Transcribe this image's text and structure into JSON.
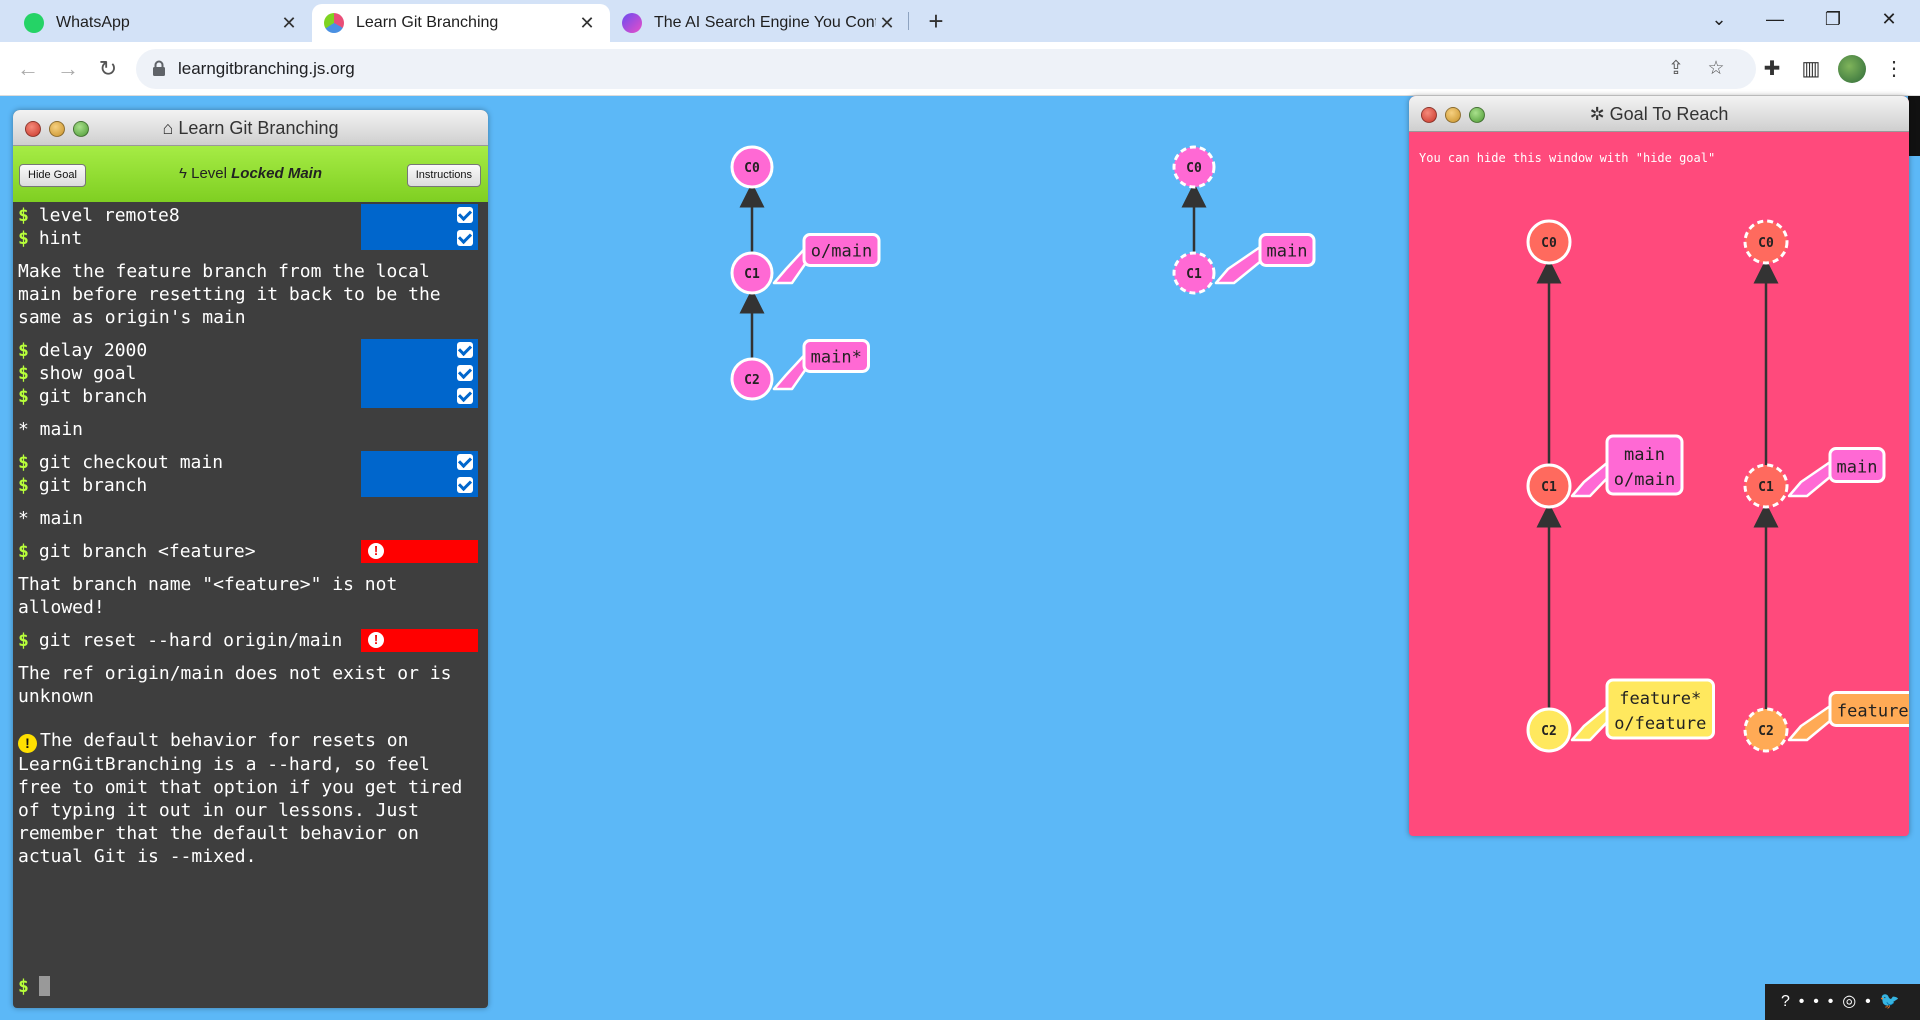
{
  "browser": {
    "tabs": [
      {
        "title": "WhatsApp"
      },
      {
        "title": "Learn Git Branching"
      },
      {
        "title": "The AI Search Engine You Contro"
      }
    ],
    "url": "learngitbranching.js.org"
  },
  "terminal": {
    "title": "Learn Git Branching",
    "hide_goal_label": "Hide Goal",
    "instructions_label": "Instructions",
    "level_prefix": "Level",
    "level_name": "Locked Main",
    "prompt": "$",
    "entries": [
      {
        "cmd": "level remote8",
        "status": "ok"
      },
      {
        "cmd": "hint",
        "status": "ok"
      },
      {
        "output": "Make the feature branch from the local main before resetting it back to be the same as origin's main"
      },
      {
        "cmd": "delay 2000",
        "status": "ok"
      },
      {
        "cmd": "show goal",
        "status": "ok"
      },
      {
        "cmd": "git branch",
        "status": "ok"
      },
      {
        "output": "* main"
      },
      {
        "cmd": "git checkout main",
        "status": "ok"
      },
      {
        "cmd": "git branch",
        "status": "ok"
      },
      {
        "output": "* main"
      },
      {
        "cmd": "git branch <feature>",
        "status": "error"
      },
      {
        "output": "That branch name \"<feature>\" is not allowed!"
      },
      {
        "cmd": "git reset --hard origin/main",
        "status": "error"
      },
      {
        "output": "The ref origin/main does not exist or is unknown"
      }
    ],
    "warning_icon": "!",
    "warning": "The default behavior for resets on LearnGitBranching is a --hard, so feel free to omit that option if you get tired of typing it out in our lessons. Just remember that the default behavior on actual Git is --mixed.",
    "error_icon": "!"
  },
  "visualization": {
    "local": {
      "commits": [
        "C0",
        "C1",
        "C2"
      ],
      "branches": [
        {
          "name": "o/main",
          "target": "C1"
        },
        {
          "name": "main*",
          "target": "C2"
        }
      ]
    },
    "remote": {
      "commits": [
        "C0",
        "C1"
      ],
      "branches": [
        {
          "name": "main",
          "target": "C1"
        }
      ]
    }
  },
  "goal": {
    "title": "Goal To Reach",
    "hint": "You can hide this window with \"hide goal\"",
    "local": {
      "commits": [
        "C0",
        "C1",
        "C2"
      ],
      "branches": [
        {
          "name": "main\no/main",
          "target": "C1"
        },
        {
          "name": "feature*\no/feature",
          "target": "C2"
        }
      ]
    },
    "remote": {
      "commits": [
        "C0",
        "C1",
        "C2"
      ],
      "branches": [
        {
          "name": "main",
          "target": "C1"
        },
        {
          "name": "feature",
          "target": "C2"
        }
      ]
    }
  },
  "colors": {
    "background": "#5cb8f7",
    "commit_pink": "#ff69d4",
    "goal_background": "#ff4a7c",
    "goal_commit": "#ff6a5e",
    "goal_c2": "#ffe85e",
    "remote_feature": "#ffaa55",
    "prompt_green": "#b8ff3a",
    "ok_blue": "#0066cc",
    "error_red": "#ff0000"
  },
  "footer": {
    "icons": [
      "help-icon",
      "globe-icon",
      "twitter-icon"
    ]
  }
}
